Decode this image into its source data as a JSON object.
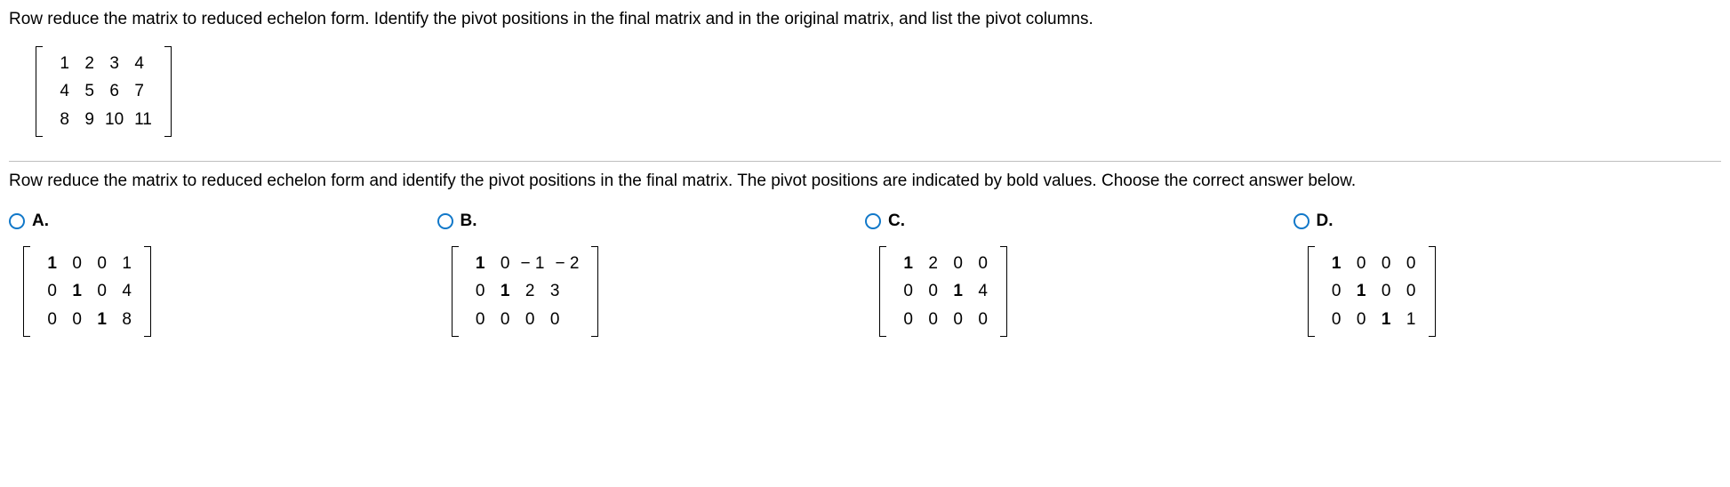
{
  "instruction": "Row reduce the matrix to reduced echelon form. Identify the pivot positions in the final matrix and in the original matrix, and list the pivot columns.",
  "problem_matrix": [
    [
      "1",
      "2",
      "3",
      "4"
    ],
    [
      "4",
      "5",
      "6",
      "7"
    ],
    [
      "8",
      "9",
      "10",
      "11"
    ]
  ],
  "sub_instruction": "Row reduce the matrix to reduced echelon form and identify the pivot positions in the final matrix. The pivot positions are indicated by bold values. Choose the correct answer below.",
  "choices": {
    "A": {
      "label": "A.",
      "matrix": [
        [
          {
            "v": "1",
            "b": true
          },
          {
            "v": "0"
          },
          {
            "v": "0"
          },
          {
            "v": "1"
          }
        ],
        [
          {
            "v": "0"
          },
          {
            "v": "1",
            "b": true
          },
          {
            "v": "0"
          },
          {
            "v": "4"
          }
        ],
        [
          {
            "v": "0"
          },
          {
            "v": "0"
          },
          {
            "v": "1",
            "b": true
          },
          {
            "v": "8"
          }
        ]
      ]
    },
    "B": {
      "label": "B.",
      "matrix": [
        [
          {
            "v": "1",
            "b": true
          },
          {
            "v": "0"
          },
          {
            "v": "− 1"
          },
          {
            "v": "− 2"
          }
        ],
        [
          {
            "v": "0"
          },
          {
            "v": "1",
            "b": true
          },
          {
            "v": "2"
          },
          {
            "v": "3"
          }
        ],
        [
          {
            "v": "0"
          },
          {
            "v": "0"
          },
          {
            "v": "0"
          },
          {
            "v": "0"
          }
        ]
      ]
    },
    "C": {
      "label": "C.",
      "matrix": [
        [
          {
            "v": "1",
            "b": true
          },
          {
            "v": "2"
          },
          {
            "v": "0"
          },
          {
            "v": "0"
          }
        ],
        [
          {
            "v": "0"
          },
          {
            "v": "0"
          },
          {
            "v": "1",
            "b": true
          },
          {
            "v": "4"
          }
        ],
        [
          {
            "v": "0"
          },
          {
            "v": "0"
          },
          {
            "v": "0"
          },
          {
            "v": "0"
          }
        ]
      ]
    },
    "D": {
      "label": "D.",
      "matrix": [
        [
          {
            "v": "1",
            "b": true
          },
          {
            "v": "0"
          },
          {
            "v": "0"
          },
          {
            "v": "0"
          }
        ],
        [
          {
            "v": "0"
          },
          {
            "v": "1",
            "b": true
          },
          {
            "v": "0"
          },
          {
            "v": "0"
          }
        ],
        [
          {
            "v": "0"
          },
          {
            "v": "0"
          },
          {
            "v": "1",
            "b": true
          },
          {
            "v": "1"
          }
        ]
      ]
    }
  }
}
